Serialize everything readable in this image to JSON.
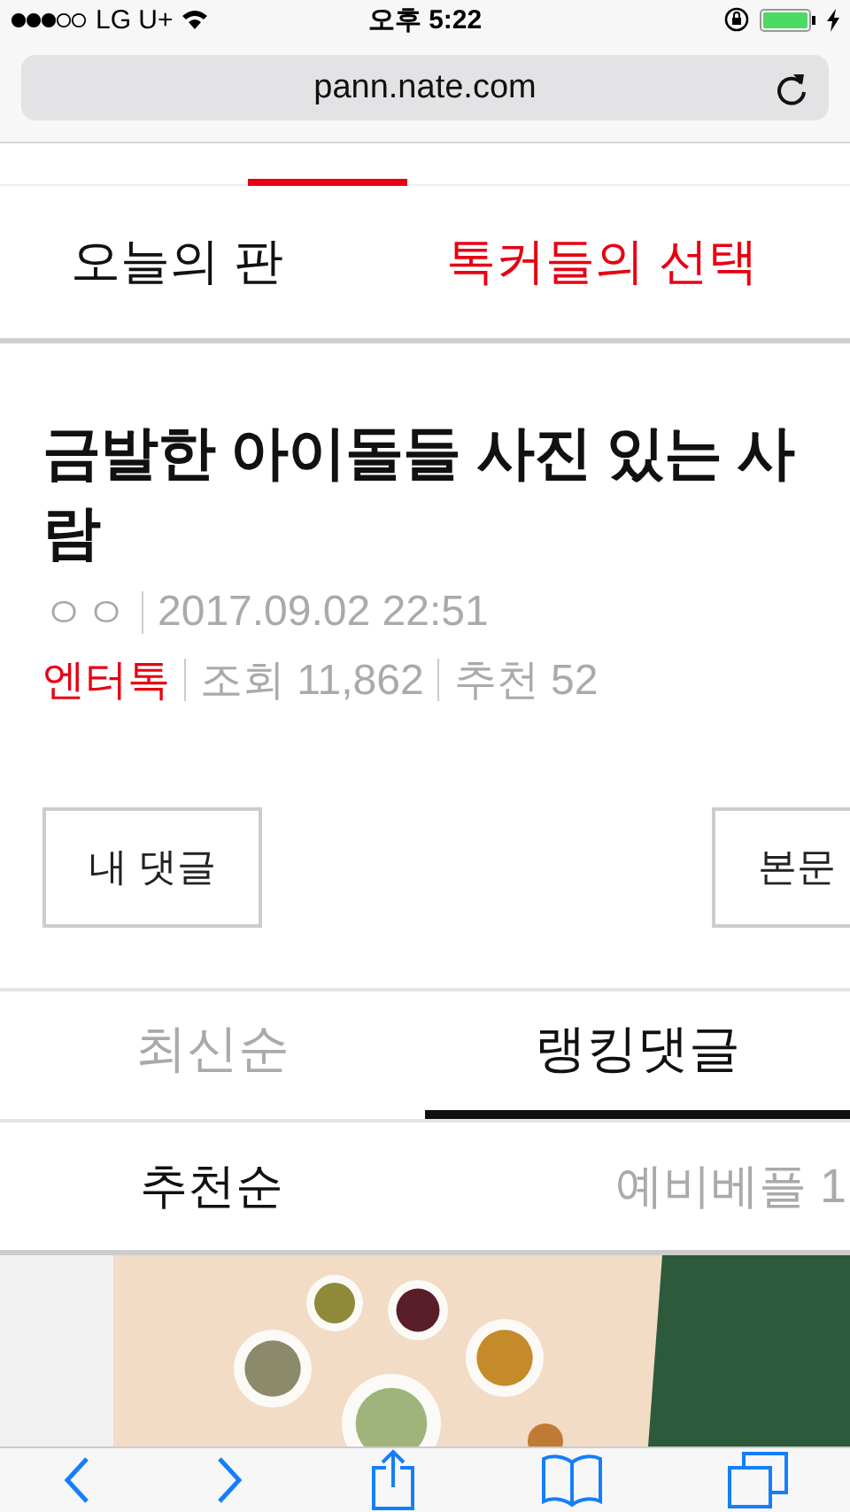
{
  "status_bar": {
    "carrier": "LG U+",
    "time": "오후 5:22"
  },
  "address_bar": {
    "url": "pann.nate.com"
  },
  "section_tabs": [
    {
      "label": "오늘의 판",
      "selected": false
    },
    {
      "label": "톡커들의 선택",
      "selected": true
    }
  ],
  "post": {
    "title": "금발한 아이돌들 사진 있는 사람",
    "author": "ㅇㅇ",
    "date": "2017.09.02 22:51",
    "category": "엔터톡",
    "views": "조회 11,862",
    "recommends": "추천 52"
  },
  "action_buttons": [
    "내 댓글",
    "본문"
  ],
  "comment_tabs": [
    {
      "label": "최신순",
      "selected": false
    },
    {
      "label": "랭킹댓글",
      "selected": true
    }
  ],
  "sort_tabs": [
    {
      "label": "추천순",
      "selected": true
    },
    {
      "label": "예비베플 1",
      "selected": false
    }
  ]
}
